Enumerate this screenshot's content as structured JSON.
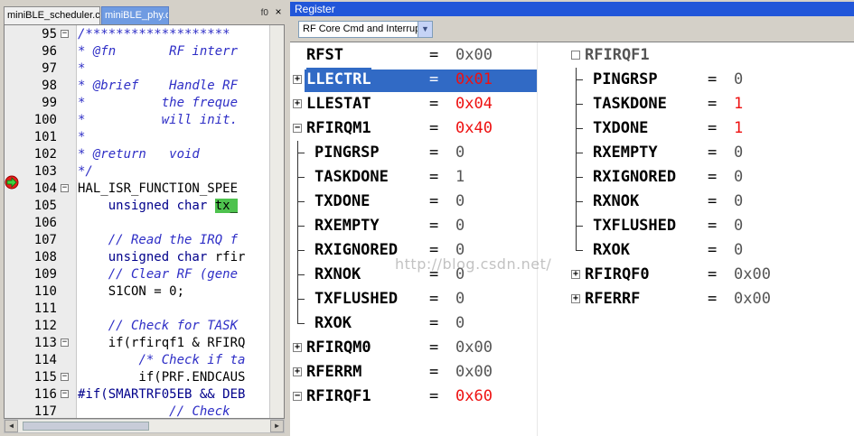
{
  "editor": {
    "tabs": [
      {
        "label": "miniBLE_scheduler.c",
        "active": false
      },
      {
        "label": "miniBLE_phy.c",
        "active": true
      }
    ],
    "tab_marker": "f0",
    "close_glyph": "×",
    "lines": [
      {
        "n": "95",
        "fold": "−",
        "code": [
          {
            "t": "cm",
            "s": "/*******************"
          }
        ]
      },
      {
        "n": "96",
        "fold": "",
        "code": [
          {
            "t": "cm",
            "s": "* @fn       RF interr"
          }
        ]
      },
      {
        "n": "97",
        "fold": "",
        "code": [
          {
            "t": "cm",
            "s": "*"
          }
        ]
      },
      {
        "n": "98",
        "fold": "",
        "code": [
          {
            "t": "cm",
            "s": "* @brief    Handle RF"
          }
        ]
      },
      {
        "n": "99",
        "fold": "",
        "code": [
          {
            "t": "cm",
            "s": "*          the freque"
          }
        ]
      },
      {
        "n": "100",
        "fold": "",
        "code": [
          {
            "t": "cm",
            "s": "*          will init."
          }
        ]
      },
      {
        "n": "101",
        "fold": "",
        "code": [
          {
            "t": "cm",
            "s": "*"
          }
        ]
      },
      {
        "n": "102",
        "fold": "",
        "code": [
          {
            "t": "cm",
            "s": "* @return   void"
          }
        ]
      },
      {
        "n": "103",
        "fold": "",
        "code": [
          {
            "t": "cm",
            "s": "*/"
          }
        ]
      },
      {
        "n": "104",
        "fold": "−",
        "code": [
          {
            "t": "tx",
            "s": "HAL_ISR_FUNCTION_SPEE"
          }
        ]
      },
      {
        "n": "105",
        "fold": "",
        "code": [
          {
            "t": "tx",
            "s": "    "
          },
          {
            "t": "kw",
            "s": "unsigned char "
          },
          {
            "t": "hl",
            "s": "tx_"
          }
        ]
      },
      {
        "n": "106",
        "fold": "",
        "code": []
      },
      {
        "n": "107",
        "fold": "",
        "code": [
          {
            "t": "tx",
            "s": "    "
          },
          {
            "t": "cm",
            "s": "// Read the IRQ f"
          }
        ]
      },
      {
        "n": "108",
        "fold": "",
        "code": [
          {
            "t": "tx",
            "s": "    "
          },
          {
            "t": "kw",
            "s": "unsigned char "
          },
          {
            "t": "tx",
            "s": "rfir"
          }
        ]
      },
      {
        "n": "109",
        "fold": "",
        "code": [
          {
            "t": "tx",
            "s": "    "
          },
          {
            "t": "cm",
            "s": "// Clear RF (gene"
          }
        ]
      },
      {
        "n": "110",
        "fold": "",
        "code": [
          {
            "t": "tx",
            "s": "    S1CON = 0;"
          }
        ]
      },
      {
        "n": "111",
        "fold": "",
        "code": []
      },
      {
        "n": "112",
        "fold": "",
        "code": [
          {
            "t": "tx",
            "s": "    "
          },
          {
            "t": "cm",
            "s": "// Check for TASK"
          }
        ]
      },
      {
        "n": "113",
        "fold": "−",
        "code": [
          {
            "t": "tx",
            "s": "    if(rfirqf1 & RFIRQ"
          }
        ]
      },
      {
        "n": "114",
        "fold": "",
        "code": [
          {
            "t": "tx",
            "s": "        "
          },
          {
            "t": "cm",
            "s": "/* Check if ta"
          }
        ]
      },
      {
        "n": "115",
        "fold": "−",
        "code": [
          {
            "t": "tx",
            "s": "        if(PRF.ENDCAUS"
          }
        ]
      },
      {
        "n": "116",
        "fold": "−",
        "code": [
          {
            "t": "kw",
            "s": "#if(SMARTRF05EB && DEB"
          }
        ]
      },
      {
        "n": "117",
        "fold": "",
        "code": [
          {
            "t": "tx",
            "s": "            "
          },
          {
            "t": "cm",
            "s": "// Check "
          }
        ]
      }
    ]
  },
  "register": {
    "title": "Register",
    "group": "RF Core Cmd and Interrup",
    "dropdown_icon": "chevron-down-icon",
    "left_column": [
      {
        "name": "RFST",
        "value": "0x00",
        "changed": false,
        "expander": "none",
        "indent": 0
      },
      {
        "name": "LLECTRL",
        "value": "0x01",
        "changed": true,
        "expander": "+",
        "indent": 0,
        "selected": true
      },
      {
        "name": "LLESTAT",
        "value": "0x04",
        "changed": true,
        "expander": "+",
        "indent": 0
      },
      {
        "name": "RFIRQM1",
        "value": "0x40",
        "changed": true,
        "expander": "-",
        "indent": 0
      },
      {
        "name": "PINGRSP",
        "value": "0",
        "changed": false,
        "expander": "none",
        "indent": 1
      },
      {
        "name": "TASKDONE",
        "value": "1",
        "changed": false,
        "expander": "none",
        "indent": 1
      },
      {
        "name": "TXDONE",
        "value": "0",
        "changed": false,
        "expander": "none",
        "indent": 1
      },
      {
        "name": "RXEMPTY",
        "value": "0",
        "changed": false,
        "expander": "none",
        "indent": 1
      },
      {
        "name": "RXIGNORED",
        "value": "0",
        "changed": false,
        "expander": "none",
        "indent": 1
      },
      {
        "name": "RXNOK",
        "value": "0",
        "changed": false,
        "expander": "none",
        "indent": 1
      },
      {
        "name": "TXFLUSHED",
        "value": "0",
        "changed": false,
        "expander": "none",
        "indent": 1
      },
      {
        "name": "RXOK",
        "value": "0",
        "changed": false,
        "expander": "none",
        "indent": 1,
        "last": true
      },
      {
        "name": "RFIRQM0",
        "value": "0x00",
        "changed": false,
        "expander": "+",
        "indent": 0
      },
      {
        "name": "RFERRM",
        "value": "0x00",
        "changed": false,
        "expander": "+",
        "indent": 0
      },
      {
        "name": "RFIRQF1",
        "value": "0x60",
        "changed": true,
        "expander": "-",
        "indent": 0
      }
    ],
    "right_column": [
      {
        "name": "RFIRQF1",
        "value": "",
        "changed": false,
        "expander": "box",
        "indent": 0,
        "dim": true
      },
      {
        "name": "PINGRSP",
        "value": "0",
        "changed": false,
        "expander": "none",
        "indent": 1
      },
      {
        "name": "TASKDONE",
        "value": "1",
        "changed": true,
        "expander": "none",
        "indent": 1
      },
      {
        "name": "TXDONE",
        "value": "1",
        "changed": true,
        "expander": "none",
        "indent": 1
      },
      {
        "name": "RXEMPTY",
        "value": "0",
        "changed": false,
        "expander": "none",
        "indent": 1
      },
      {
        "name": "RXIGNORED",
        "value": "0",
        "changed": false,
        "expander": "none",
        "indent": 1
      },
      {
        "name": "RXNOK",
        "value": "0",
        "changed": false,
        "expander": "none",
        "indent": 1
      },
      {
        "name": "TXFLUSHED",
        "value": "0",
        "changed": false,
        "expander": "none",
        "indent": 1
      },
      {
        "name": "RXOK",
        "value": "0",
        "changed": false,
        "expander": "none",
        "indent": 1,
        "last": true
      },
      {
        "name": "RFIRQF0",
        "value": "0x00",
        "changed": false,
        "expander": "+",
        "indent": 0
      },
      {
        "name": "RFERRF",
        "value": "0x00",
        "changed": false,
        "expander": "+",
        "indent": 0
      }
    ],
    "eq": "=",
    "watermark": "http://blog.csdn.net/"
  }
}
